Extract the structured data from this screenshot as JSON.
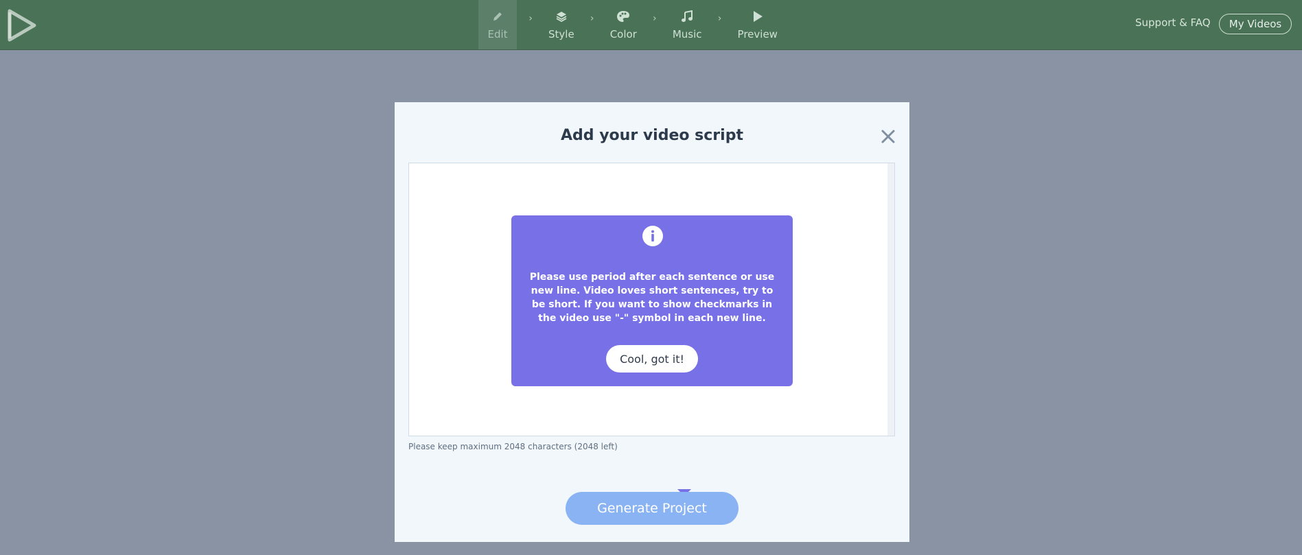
{
  "nav": {
    "steps": [
      {
        "label": "Edit",
        "icon": "pencil-icon"
      },
      {
        "label": "Style",
        "icon": "layers-icon"
      },
      {
        "label": "Color",
        "icon": "palette-icon"
      },
      {
        "label": "Music",
        "icon": "music-note-icon"
      },
      {
        "label": "Preview",
        "icon": "play-icon"
      }
    ],
    "support_label": "Support & FAQ",
    "my_videos_label": "My Videos"
  },
  "modal": {
    "title": "Add your video script",
    "char_hint": "Please keep maximum 2048 characters (2048 left)",
    "generate_label": "Generate Project"
  },
  "tooltip": {
    "message": "Please use period after each sentence or use new line. Video loves short sentences, try to be short. If you want to show checkmarks in the video use \"-\" symbol in each new line.",
    "button_label": "Cool, got it!"
  },
  "colors": {
    "topbar": "#4a7257",
    "overlay": "#8a93a3",
    "tooltip": "#7770e6",
    "generate_button": "#8ab3f3"
  }
}
